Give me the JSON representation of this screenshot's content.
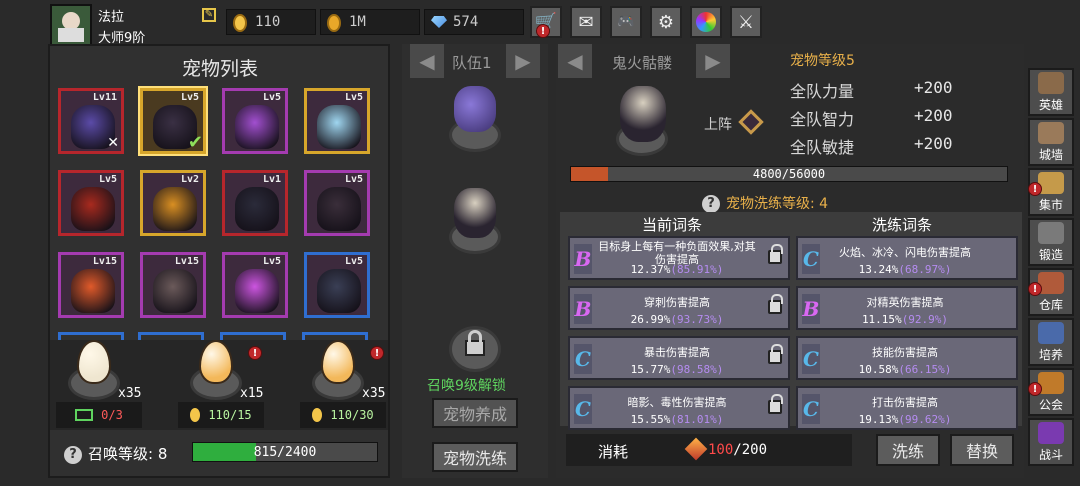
{
  "player": {
    "name": "法拉",
    "rank": "大师9阶"
  },
  "resources": {
    "coins": "110",
    "gold": "1M",
    "gems": "574"
  },
  "top_buttons": [
    "shop",
    "mail",
    "gamepad",
    "settings",
    "camera",
    "sword"
  ],
  "pet_list": {
    "title": "宠物列表",
    "pets": [
      {
        "level": "Lv11",
        "border": "red",
        "color": "#5b4ba8"
      },
      {
        "level": "Lv5",
        "border": "gold",
        "color": "#3a3044",
        "selected": true
      },
      {
        "level": "Lv5",
        "border": "purple",
        "color": "#a24fd0"
      },
      {
        "level": "Lv5",
        "border": "gold",
        "color": "#9fd6f0"
      },
      {
        "level": "Lv5",
        "border": "red",
        "color": "#a82a1e"
      },
      {
        "level": "Lv2",
        "border": "gold",
        "color": "#d98f22"
      },
      {
        "level": "Lv1",
        "border": "red",
        "color": "#2b2b3a"
      },
      {
        "level": "Lv5",
        "border": "purple",
        "color": "#3a2e3a"
      },
      {
        "level": "Lv15",
        "border": "purple",
        "color": "#e05a2a"
      },
      {
        "level": "Lv15",
        "border": "purple",
        "color": "#6b5a5a"
      },
      {
        "level": "Lv5",
        "border": "purple",
        "color": "#cc55e0"
      },
      {
        "level": "Lv5",
        "border": "blue",
        "color": "#3a3f55"
      }
    ]
  },
  "eggs": [
    {
      "count": "x35",
      "progress": "0/3",
      "tint": "#efe6d0",
      "alert": false,
      "progress_color": "#ff5a5a"
    },
    {
      "count": "x15",
      "progress": "110/15",
      "tint": "#f3b85a",
      "alert": true,
      "progress_color": "#b9f5a0"
    },
    {
      "count": "x35",
      "progress": "110/30",
      "tint": "#f3b85a",
      "alert": true,
      "progress_color": "#b9f5a0"
    }
  ],
  "summon": {
    "label": "召唤等级: 8",
    "progress": "815/2400",
    "fraction": 0.34
  },
  "team": {
    "title": "队伍1",
    "unlock_text": "召唤9级解锁",
    "raise_button": "宠物养成",
    "refine_button": "宠物洗练"
  },
  "pet_detail": {
    "name": "鬼火骷髅",
    "level_text": "宠物等级5",
    "deploy_label": "上阵",
    "stats": [
      {
        "name": "全队力量",
        "value": "+200"
      },
      {
        "name": "全队智力",
        "value": "+200"
      },
      {
        "name": "全队敏捷",
        "value": "+200"
      }
    ],
    "exp": "4800/56000",
    "exp_fraction": 0.0857,
    "refine_level": "宠物洗练等级: 4"
  },
  "affixes": {
    "current_title": "当前词条",
    "refine_title": "洗练词条",
    "current": [
      {
        "grade": "B",
        "desc": "目标身上每有一种负面效果,对其伤害提高",
        "value": "12.37%",
        "range": "(85.91%)"
      },
      {
        "grade": "B",
        "desc": "穿刺伤害提高",
        "value": "26.99%",
        "range": "(93.73%)"
      },
      {
        "grade": "C",
        "desc": "暴击伤害提高",
        "value": "15.77%",
        "range": "(98.58%)"
      },
      {
        "grade": "C",
        "desc": "暗影、毒性伤害提高",
        "value": "15.55%",
        "range": "(81.01%)"
      }
    ],
    "refine": [
      {
        "grade": "C",
        "desc": "火焰、冰冷、闪电伤害提高",
        "value": "13.24%",
        "range": "(68.97%)"
      },
      {
        "grade": "B",
        "desc": "对精英伤害提高",
        "value": "11.15%",
        "range": "(92.9%)"
      },
      {
        "grade": "C",
        "desc": "技能伤害提高",
        "value": "10.58%",
        "range": "(66.15%)"
      },
      {
        "grade": "C",
        "desc": "打击伤害提高",
        "value": "19.13%",
        "range": "(99.62%)"
      }
    ]
  },
  "consume": {
    "label": "消耗",
    "have": "100",
    "need": "/200"
  },
  "actions": {
    "refine": "洗练",
    "replace": "替换"
  },
  "side_menu": [
    {
      "label": "英雄",
      "alert": false,
      "color": "#8a6a4a"
    },
    {
      "label": "城墙",
      "alert": false,
      "color": "#9a7a5a"
    },
    {
      "label": "集市",
      "alert": true,
      "color": "#c59a4a"
    },
    {
      "label": "锻造",
      "alert": false,
      "color": "#7a7a7a"
    },
    {
      "label": "仓库",
      "alert": true,
      "color": "#b05a3a"
    },
    {
      "label": "培养",
      "alert": false,
      "color": "#4a6aaa"
    },
    {
      "label": "公会",
      "alert": true,
      "color": "#c07a2a"
    },
    {
      "label": "战斗",
      "alert": false,
      "color": "#7a3ab0"
    }
  ]
}
